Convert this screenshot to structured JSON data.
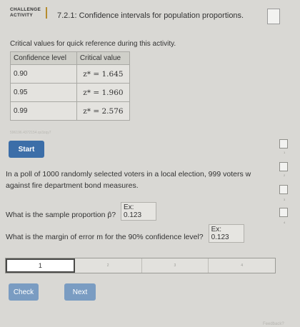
{
  "header": {
    "badge_line1": "CHALLENGE",
    "badge_line2": "ACTIVITY",
    "title": "7.2.1: Confidence intervals for population proportions."
  },
  "subtitle": "Critical values for quick reference during this activity.",
  "table": {
    "headers": [
      "Confidence level",
      "Critical value"
    ],
    "rows": [
      {
        "level": "0.90",
        "value": "z* = 1.645"
      },
      {
        "level": "0.95",
        "value": "z* = 1.960"
      },
      {
        "level": "0.99",
        "value": "z* = 2.576"
      }
    ]
  },
  "faint_id": "596196.4372154.qx3zqy7",
  "start_label": "Start",
  "question1": "In a poll of 1000 randomly selected voters in a local election, 999 voters w against fire department bond measures.",
  "question2": "What is the sample proportion p̂?",
  "question2_answer": "Ex: 0.123",
  "question3": "What is the margin of error m for the 90% confidence level?",
  "question3_answer": "Ex: 0.123",
  "right_numbers": [
    "1",
    "2",
    "3",
    "4"
  ],
  "progress": [
    "1",
    "2",
    "3",
    "4"
  ],
  "check_label": "Check",
  "next_label": "Next",
  "feedback": "Feedback?"
}
